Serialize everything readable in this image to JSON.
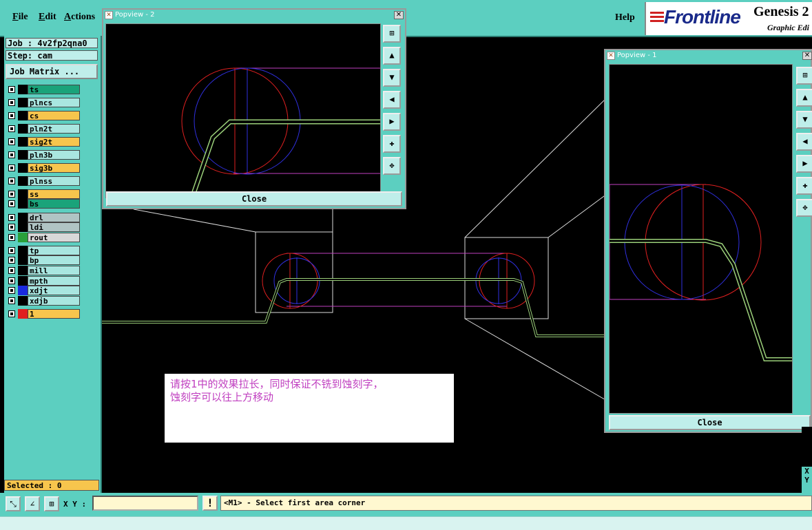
{
  "menu": {
    "file": "File",
    "edit": "Edit",
    "actions": "Actions",
    "help": "Help"
  },
  "brand": {
    "logo": "Frontline",
    "product": "Genesis 2",
    "subtitle": "Graphic Edi"
  },
  "job": {
    "job_label": "Job : 4v2fp2qna0",
    "step_label": "Step: cam",
    "matrix_button": "Job Matrix ..."
  },
  "layers": [
    {
      "name": "ts",
      "color": "#1aa37a"
    },
    {
      "name": "plncs",
      "color": "#a9e6e0"
    },
    {
      "name": "cs",
      "color": "#f7c54d"
    },
    {
      "name": "pln2t",
      "color": "#a9e6e0"
    },
    {
      "name": "sig2t",
      "color": "#f7c54d"
    },
    {
      "name": "pln3b",
      "color": "#a9e6e0"
    },
    {
      "name": "sig3b",
      "color": "#f7c54d"
    },
    {
      "name": "plnss",
      "color": "#a9e6e0"
    },
    {
      "name": "ss",
      "color": "#f7c54d"
    },
    {
      "name": "bs",
      "color": "#1aa37a"
    },
    {
      "name": "drl",
      "color": "#b0c4c4"
    },
    {
      "name": "ldi",
      "color": "#b0c4c4"
    },
    {
      "name": "rout",
      "color": "#d8d8d8"
    },
    {
      "name": "tp",
      "color": "#a9e6e0"
    },
    {
      "name": "bp",
      "color": "#a9e6e0"
    },
    {
      "name": "mill",
      "color": "#a9e6e0"
    },
    {
      "name": "mpth",
      "color": "#a9e6e0"
    },
    {
      "name": "xdjt",
      "color": "#a9e6e0"
    },
    {
      "name": "xdjb",
      "color": "#a9e6e0"
    },
    {
      "name": "1",
      "color": "#f7c54d"
    }
  ],
  "selected": "Selected : 0",
  "xy_label": "X Y :",
  "status": "<M1> - Select first area corner",
  "popup2": {
    "title": "Popview - 2",
    "close": "Close"
  },
  "popup1": {
    "title": "Popview - 1",
    "close": "Close"
  },
  "note": {
    "line1": "请按1中的效果拉长，同时保证不铣到蚀刻字，",
    "line2": "蚀刻字可以往上方移动"
  },
  "right_xy": {
    "x": "X",
    "y": "Y"
  }
}
